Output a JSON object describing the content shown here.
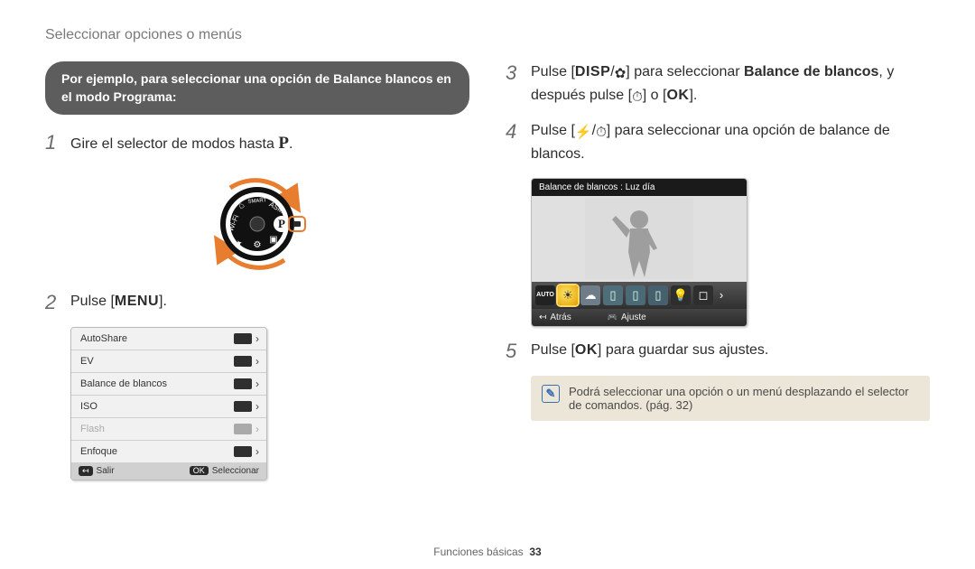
{
  "header": "Seleccionar opciones o menús",
  "pill": "Por ejemplo, para seleccionar una opción de Balance blancos en el modo Programa:",
  "steps": {
    "s1_pre": "Gire el selector de modos hasta ",
    "s1_mode": "P",
    "s1_post": ".",
    "s2_pre": "Pulse [",
    "s2_btn": "MENU",
    "s2_post": "].",
    "s3_a": "Pulse [",
    "s3_btn1": "DISP",
    "s3_sep": "/",
    "s3_icon": "✿",
    "s3_b": "] para seleccionar ",
    "s3_bold": "Balance de blancos",
    "s3_c": ", y después pulse [",
    "s3_icon2": "⏱",
    "s3_d": "] o [",
    "s3_btn2": "OK",
    "s3_e": "].",
    "s4_a": "Pulse [",
    "s4_icon1": "⚡",
    "s4_sep": "/",
    "s4_icon2": "⏱",
    "s4_b": "] para seleccionar una opción de balance de blancos.",
    "s5_a": "Pulse [",
    "s5_btn": "OK",
    "s5_b": "] para guardar sus ajustes."
  },
  "menu": {
    "items": [
      {
        "label": "AutoShare"
      },
      {
        "label": "EV"
      },
      {
        "label": "Balance de blancos"
      },
      {
        "label": "ISO"
      },
      {
        "label": "Flash",
        "disabled": true
      },
      {
        "label": "Enfoque"
      }
    ],
    "footer": {
      "left_key": "↤",
      "left": "Salir",
      "right_key": "OK",
      "right": "Seleccionar"
    }
  },
  "wb": {
    "title": "Balance de blancos : Luz día",
    "active_marker": "ˆ",
    "options": {
      "awb": "AUTO",
      "day": "☀",
      "cloud": "☁",
      "fl1": "▯",
      "fl2": "▯",
      "fl3": "▯",
      "inc": "💡",
      "cust": "◻",
      "next": "›"
    },
    "footer": {
      "back": "Atrás",
      "set": "Ajuste"
    }
  },
  "note": {
    "icon": "✎",
    "text": "Podrá seleccionar una opción o un menú desplazando el selector de comandos. (pág. 32)"
  },
  "footer": {
    "label": "Funciones básicas",
    "page": "33"
  }
}
